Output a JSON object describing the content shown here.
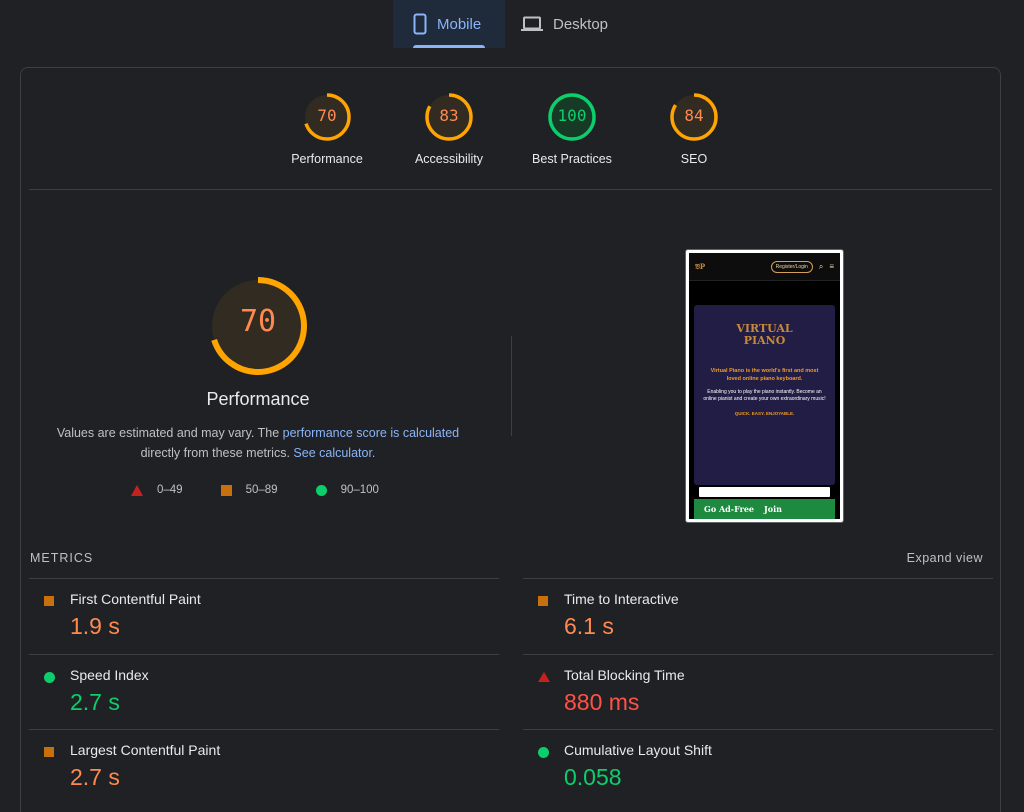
{
  "tabs": [
    {
      "label": "Mobile",
      "icon": "mobile-phone-icon",
      "active": true
    },
    {
      "label": "Desktop",
      "icon": "laptop-icon",
      "active": false
    }
  ],
  "categories": [
    {
      "score": "70",
      "label": "Performance",
      "fraction": 0.7,
      "color": "#ffa400"
    },
    {
      "score": "83",
      "label": "Accessibility",
      "fraction": 0.83,
      "color": "#ffa400"
    },
    {
      "score": "100",
      "label": "Best Practices",
      "fraction": 1.0,
      "color": "#0cce6b"
    },
    {
      "score": "84",
      "label": "SEO",
      "fraction": 0.84,
      "color": "#ffa400"
    }
  ],
  "performance": {
    "score": "70",
    "fraction": 0.7,
    "title": "Performance",
    "note_prefix": "Values are estimated and may vary. The ",
    "note_link1": "performance score is calculated",
    "note_mid": " directly from these metrics. ",
    "note_link2": "See calculator."
  },
  "legend": {
    "fail": "0–49",
    "average": "50–89",
    "pass": "90–100"
  },
  "screenshot": {
    "register": "Register/Login",
    "brand_line1": "VIRTUAL",
    "brand_line2": "PIANO",
    "headline": "Virtual Piano is the world's first and most loved online piano keyboard.",
    "body": "Enabling you to play the piano instantly. Become an online pianist and create your own extraordinary music!",
    "tagline": "QUICK. EASY. ENJOYABLE.",
    "ad_free": "Go Ad-Free",
    "join": "Join"
  },
  "metrics": {
    "heading": "METRICS",
    "expand": "Expand view",
    "items": [
      {
        "name": "First Contentful Paint",
        "value": "1.9 s",
        "rating": "average"
      },
      {
        "name": "Time to Interactive",
        "value": "6.1 s",
        "rating": "average"
      },
      {
        "name": "Speed Index",
        "value": "2.7 s",
        "rating": "pass"
      },
      {
        "name": "Total Blocking Time",
        "value": "880 ms",
        "rating": "fail"
      },
      {
        "name": "Largest Contentful Paint",
        "value": "2.7 s",
        "rating": "average"
      },
      {
        "name": "Cumulative Layout Shift",
        "value": "0.058",
        "rating": "pass"
      }
    ]
  }
}
